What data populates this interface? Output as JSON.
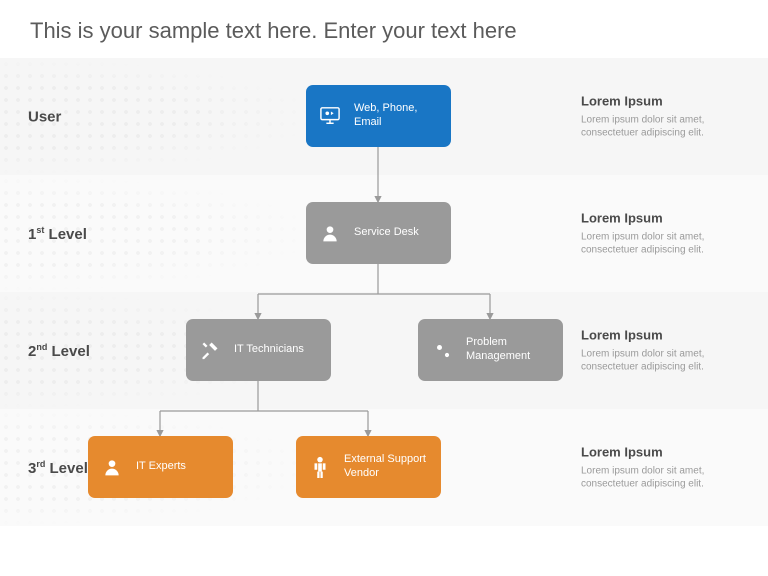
{
  "title": "This is your sample text here. Enter your text here",
  "rows": [
    {
      "label_main": "User",
      "label_sup": "",
      "desc_title": "Lorem Ipsum",
      "desc_body": "Lorem ipsum dolor sit amet, consectetuer adipiscing elit."
    },
    {
      "label_main": "1",
      "label_sup": "st",
      "label_suffix": " Level",
      "desc_title": "Lorem Ipsum",
      "desc_body": "Lorem ipsum dolor sit amet, consectetuer adipiscing elit."
    },
    {
      "label_main": "2",
      "label_sup": "nd",
      "label_suffix": " Level",
      "desc_title": "Lorem Ipsum",
      "desc_body": "Lorem ipsum dolor sit amet, consectetuer adipiscing elit."
    },
    {
      "label_main": "3",
      "label_sup": "rd",
      "label_suffix": " Level",
      "desc_title": "Lorem Ipsum",
      "desc_body": "Lorem ipsum dolor sit amet, consectetuer adipiscing elit."
    }
  ],
  "nodes": {
    "user": {
      "label": "Web, Phone, Email",
      "color": "blue",
      "icon": "monitor"
    },
    "service_desk": {
      "label": "Service Desk",
      "color": "gray",
      "icon": "person"
    },
    "it_tech": {
      "label": "IT Technicians",
      "color": "gray",
      "icon": "tools"
    },
    "problem_mgmt": {
      "label": "Problem Management",
      "color": "gray",
      "icon": "gears"
    },
    "it_experts": {
      "label": "IT Experts",
      "color": "orange",
      "icon": "person"
    },
    "ext_vendor": {
      "label": "External Support Vendor",
      "color": "orange",
      "icon": "person-standing"
    }
  },
  "chart_data": {
    "type": "org-chart",
    "levels": [
      {
        "level_name": "User",
        "nodes": [
          "Web, Phone, Email"
        ]
      },
      {
        "level_name": "1st Level",
        "nodes": [
          "Service Desk"
        ]
      },
      {
        "level_name": "2nd Level",
        "nodes": [
          "IT Technicians",
          "Problem Management"
        ]
      },
      {
        "level_name": "3rd Level",
        "nodes": [
          "IT Experts",
          "External Support Vendor"
        ]
      }
    ],
    "edges": [
      [
        "Web, Phone, Email",
        "Service Desk"
      ],
      [
        "Service Desk",
        "IT Technicians"
      ],
      [
        "Service Desk",
        "Problem Management"
      ],
      [
        "IT Technicians",
        "IT Experts"
      ],
      [
        "IT Technicians",
        "External Support Vendor"
      ]
    ]
  }
}
